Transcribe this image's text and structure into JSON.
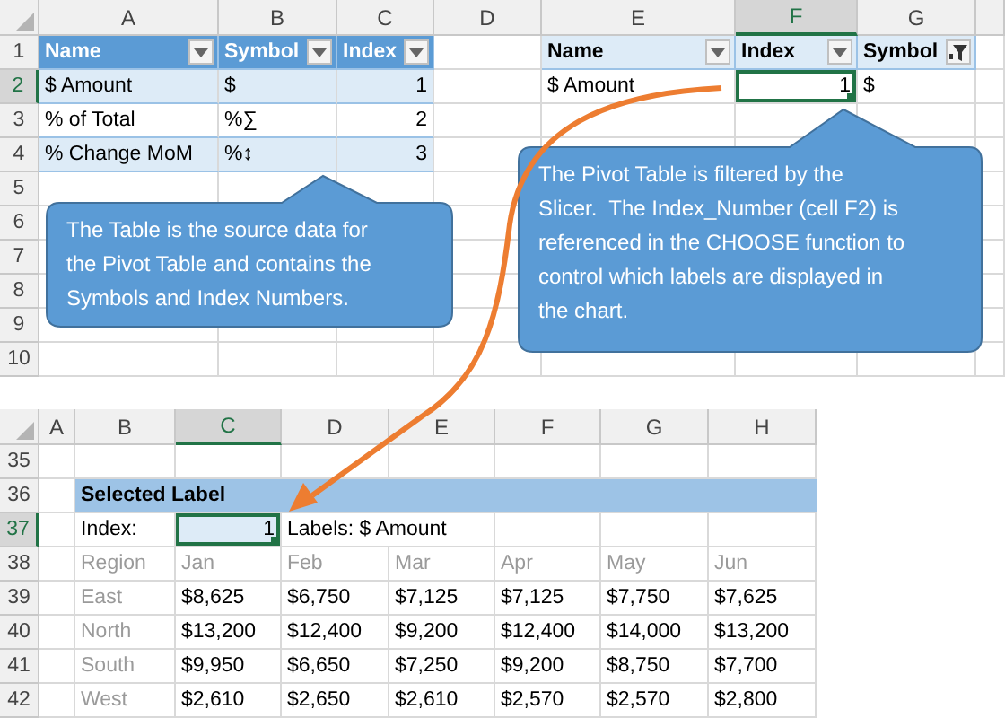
{
  "top_sheet": {
    "columns": [
      {
        "label": "A",
        "selected": false
      },
      {
        "label": "B",
        "selected": false
      },
      {
        "label": "C",
        "selected": false
      },
      {
        "label": "D",
        "selected": false
      },
      {
        "label": "E",
        "selected": false
      },
      {
        "label": "F",
        "selected": true
      },
      {
        "label": "G",
        "selected": false
      }
    ],
    "rows": [
      {
        "label": "1",
        "selected": false
      },
      {
        "label": "2",
        "selected": true
      },
      {
        "label": "3",
        "selected": false
      },
      {
        "label": "4",
        "selected": false
      },
      {
        "label": "5",
        "selected": false
      },
      {
        "label": "6",
        "selected": false
      },
      {
        "label": "7",
        "selected": false
      },
      {
        "label": "8",
        "selected": false
      },
      {
        "label": "9",
        "selected": false
      },
      {
        "label": "10",
        "selected": false
      }
    ]
  },
  "source_table": {
    "columns": [
      "Name",
      "Symbol",
      "Index"
    ],
    "rows": [
      [
        "$ Amount",
        "$",
        "1"
      ],
      [
        "% of Total",
        "%∑",
        "2"
      ],
      [
        "% Change MoM",
        "%↕",
        "3"
      ]
    ]
  },
  "pivot_table": {
    "columns": [
      {
        "label": "Name",
        "filtered": false
      },
      {
        "label": "Index",
        "filtered": false
      },
      {
        "label": "Symbol",
        "filtered": true
      }
    ],
    "rows": [
      [
        "$ Amount",
        "1",
        "$"
      ]
    ]
  },
  "callouts": [
    {
      "lines": [
        "The Table is the source data for",
        "the Pivot Table and contains the",
        "Symbols and Index Numbers."
      ]
    },
    {
      "lines": [
        "The Pivot Table is filtered by the",
        "Slicer.  The Index_Number (cell F2) is",
        "referenced in the CHOOSE function to",
        "control which labels are displayed in",
        "the chart."
      ]
    }
  ],
  "bottom_sheet": {
    "columns": [
      {
        "label": "A",
        "selected": false
      },
      {
        "label": "B",
        "selected": false
      },
      {
        "label": "C",
        "selected": true
      },
      {
        "label": "D",
        "selected": false
      },
      {
        "label": "E",
        "selected": false
      },
      {
        "label": "F",
        "selected": false
      },
      {
        "label": "G",
        "selected": false
      },
      {
        "label": "H",
        "selected": false
      }
    ],
    "rows": [
      {
        "label": "35",
        "selected": false
      },
      {
        "label": "36",
        "selected": false
      },
      {
        "label": "37",
        "selected": true
      },
      {
        "label": "38",
        "selected": false
      },
      {
        "label": "39",
        "selected": false
      },
      {
        "label": "40",
        "selected": false
      },
      {
        "label": "41",
        "selected": false
      },
      {
        "label": "42",
        "selected": false
      }
    ]
  },
  "selected_label": {
    "title": "Selected Label",
    "index_label": "Index:",
    "index_value": "1",
    "labels_text": "Labels: $ Amount"
  },
  "region_table": {
    "columns": [
      "Region",
      "Jan",
      "Feb",
      "Mar",
      "Apr",
      "May",
      "Jun"
    ],
    "rows": [
      [
        "East",
        "$8,625",
        "$6,750",
        "$7,125",
        "$7,125",
        "$7,750",
        "$7,625"
      ],
      [
        "North",
        "$13,200",
        "$12,400",
        "$9,200",
        "$12,400",
        "$14,000",
        "$13,200"
      ],
      [
        "South",
        "$9,950",
        "$6,650",
        "$7,250",
        "$9,200",
        "$8,750",
        "$7,700"
      ],
      [
        "West",
        "$2,610",
        "$2,650",
        "$2,610",
        "$2,570",
        "$2,570",
        "$2,800"
      ]
    ]
  }
}
